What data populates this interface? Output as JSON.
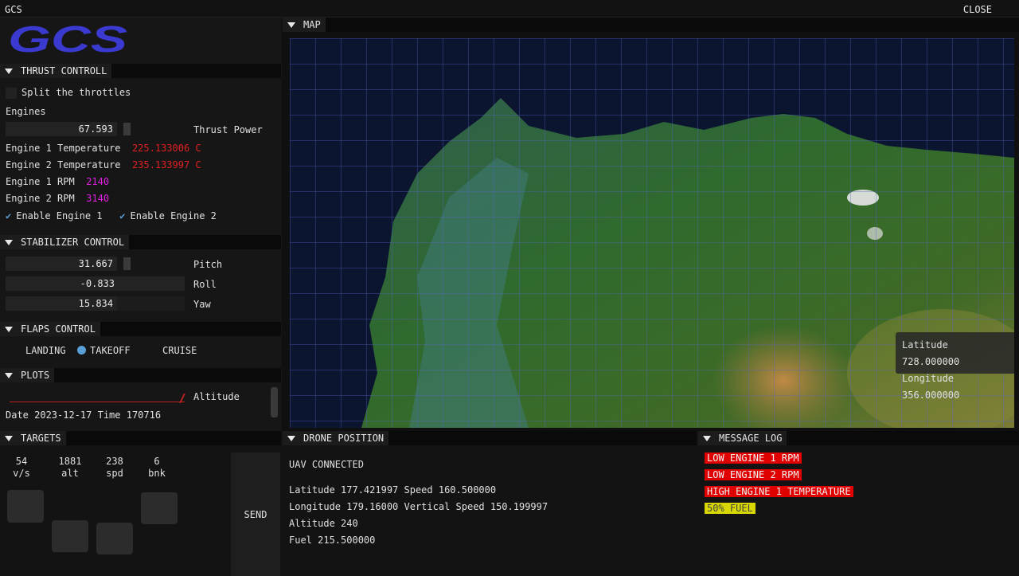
{
  "app": {
    "title": "GCS",
    "close_label": "CLOSE",
    "logo_text": "GCS"
  },
  "thrust": {
    "header": "THRUST CONTROLL",
    "split_label": "Split the throttles",
    "engines_label": "Engines",
    "thrust_value": "67.593",
    "thrust_label": "Thrust Power",
    "engine1_temp_label": "Engine 1 Temperature",
    "engine1_temp_value": "225.133006 C",
    "engine2_temp_label": "Engine 2 Temperature",
    "engine2_temp_value": "235.133997 C",
    "engine1_rpm_label": "Engine 1 RPM",
    "engine1_rpm_value": "2140",
    "engine2_rpm_label": "Engine 2 RPM",
    "engine2_rpm_value": "3140",
    "enable_engine1": "Enable Engine 1",
    "enable_engine2": "Enable Engine 2"
  },
  "stabilizer": {
    "header": "STABILIZER CONTROL",
    "pitch_value": "31.667",
    "pitch_label": "Pitch",
    "roll_value": "-0.833",
    "roll_label": "Roll",
    "yaw_value": "15.834",
    "yaw_label": "Yaw"
  },
  "flaps": {
    "header": "FLAPS CONTROL",
    "options": [
      "LANDING",
      "TAKEOFF",
      "CRUISE"
    ],
    "selected": "TAKEOFF"
  },
  "plots": {
    "header": "PLOTS",
    "altitude_label": "Altitude",
    "datetime": "Date 2023-12-17 Time 170716"
  },
  "map": {
    "header": "MAP",
    "latitude_label": "Latitude",
    "latitude_value": "728.000000",
    "longitude_label": "Longitude",
    "longitude_value": "356.000000"
  },
  "targets": {
    "header": "TARGETS",
    "stats": [
      {
        "value": "54",
        "unit": "v/s"
      },
      {
        "value": "1881",
        "unit": "alt"
      },
      {
        "value": "238",
        "unit": "spd"
      },
      {
        "value": "6",
        "unit": "bnk"
      }
    ],
    "send_label": "SEND"
  },
  "drone": {
    "header": "DRONE POSITION",
    "status": "UAV CONNECTED",
    "line1": "Latitude 177.421997 Speed 160.500000",
    "line2": "Longitude 179.16000 Vertical Speed 150.199997",
    "line3": "Altitude 240",
    "line4": "Fuel 215.500000"
  },
  "messages": {
    "header": "MESSAGE LOG",
    "items": [
      {
        "text": "LOW ENGINE 1 RPM",
        "level": "red"
      },
      {
        "text": "LOW ENGINE 2 RPM",
        "level": "red"
      },
      {
        "text": "HIGH ENGINE 1 TEMPERATURE",
        "level": "red"
      },
      {
        "text": "50% FUEL",
        "level": "yellow"
      }
    ]
  },
  "colors": {
    "accent": "#5aa0d8",
    "alert": "#e00000",
    "warn": "#d8d800",
    "ok": "#20e020"
  }
}
